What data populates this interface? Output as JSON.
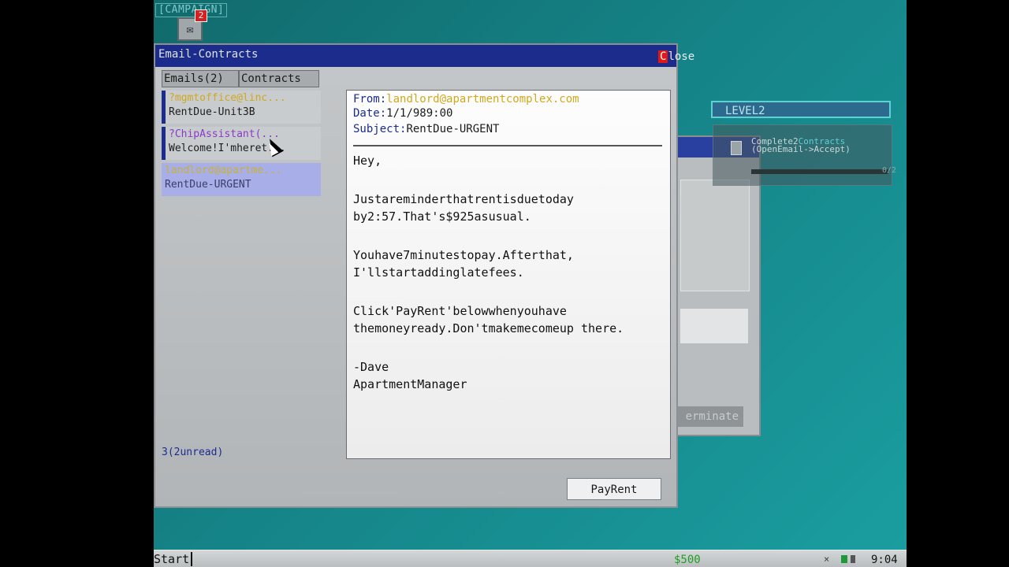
{
  "desktop": {
    "campaign_label": "[CAMPAIGN]",
    "mail_badge": "2"
  },
  "level": {
    "title": "LEVEL2",
    "task_prefix": "Complete2",
    "task_highlight": "Contracts",
    "task_hint": "(OpenEmail->Accept)",
    "progress_text": "0/2",
    "progress": 0
  },
  "background_window": {
    "terminate_label": "erminate"
  },
  "email_window": {
    "title": "Email-Contracts",
    "close_label_first": "C",
    "close_label_rest": "lose",
    "tabs": [
      {
        "label": "Emails(2)"
      },
      {
        "label": "Contracts"
      }
    ],
    "list": [
      {
        "from": "?mgmtoffice@linc...",
        "subject": "RentDue-Unit3B"
      },
      {
        "from": "?ChipAssistant(...",
        "subject": "Welcome!I'mheret..."
      },
      {
        "from": "landlord@apartme...",
        "subject": "RentDue-URGENT"
      }
    ],
    "unread_status": "3(2unread)",
    "message": {
      "from_label": "From:",
      "from_value": "landlord@apartmentcomplex.com",
      "date_label": "Date:",
      "date_value": "1/1/989:00",
      "subject_label": "Subject:",
      "subject_value": "RentDue-URGENT",
      "body": [
        "Hey,",
        "Justareminderthatrentisduetoday by2:57.That's$925asusual.",
        "Youhave7minutestopay.Afterthat, I'llstartaddinglatefees.",
        "Click'PayRent'belowwhenyouhave themoneyready.Don'tmakemecomeup there."
      ],
      "signature_name": "-Dave",
      "signature_title": "ApartmentManager"
    },
    "pay_button": "PayRent"
  },
  "taskbar": {
    "start_label": "Start",
    "money": "$500",
    "tray_close": "×",
    "clock": "9:04"
  },
  "colors": {
    "desktop": "#158387",
    "titlebar": "#1c2c8c",
    "accent_yellow": "#d0a820",
    "accent_purple": "#8b3ac8",
    "money_green": "#20a020",
    "close_red": "#e01818"
  }
}
